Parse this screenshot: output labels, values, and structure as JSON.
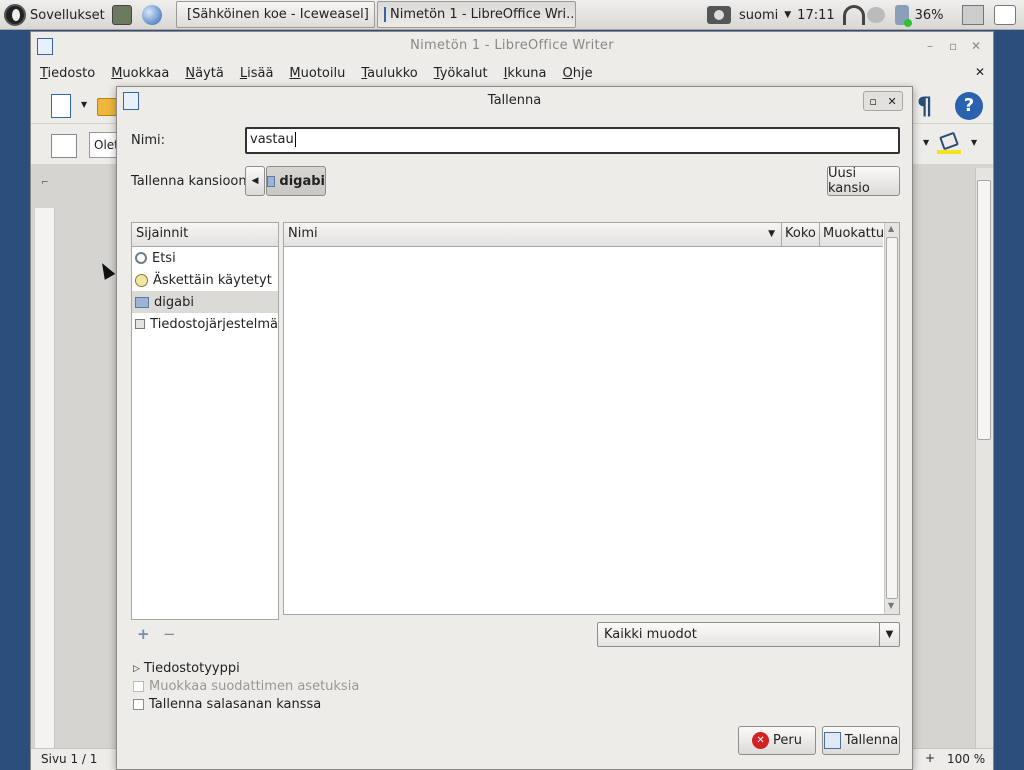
{
  "panel": {
    "apps_menu": "Sovellukset",
    "tasks": [
      {
        "label": "[Sähköinen koe - Iceweasel]"
      },
      {
        "label": "Nimetön 1 - LibreOffice Wri..."
      }
    ],
    "keyboard": "suomi",
    "clock": "17:11",
    "battery": "36%"
  },
  "writer": {
    "title": "Nimetön 1 - LibreOffice Writer",
    "menu": [
      "Tiedosto",
      "Muokkaa",
      "Näytä",
      "Lisää",
      "Muotoilu",
      "Taulukko",
      "Työkalut",
      "Ikkuna",
      "Ohje"
    ],
    "style_box": "Olet",
    "status_page": "Sivu 1 / 1",
    "zoom": "100 %"
  },
  "dialog": {
    "title": "Tallenna",
    "name_label": "Nimi:",
    "name_value": "vastau",
    "folder_label": "Tallenna kansioon:",
    "folder_current": "digabi",
    "new_folder": "Uusi kansio",
    "places_header": "Sijainnit",
    "places": [
      {
        "label": "Etsi",
        "icon": "search-icon"
      },
      {
        "label": "Äskettäin käytetyt",
        "icon": "clock-icon"
      },
      {
        "label": "digabi",
        "icon": "folder-icon"
      },
      {
        "label": "Tiedostojärjestelmä",
        "icon": "drive-icon"
      }
    ],
    "columns": {
      "name": "Nimi",
      "size": "Koko",
      "modified": "Muokattu"
    },
    "filter": "Kaikki muodot",
    "file_type": "Tiedostotyyppi",
    "edit_filter": "Muokkaa suodattimen asetuksia",
    "save_password": "Tallenna salasanan kanssa",
    "cancel": "Peru",
    "save": "Tallenna"
  },
  "colors": {
    "accent": "#2b4e7c",
    "selection": "#dcdad6"
  }
}
